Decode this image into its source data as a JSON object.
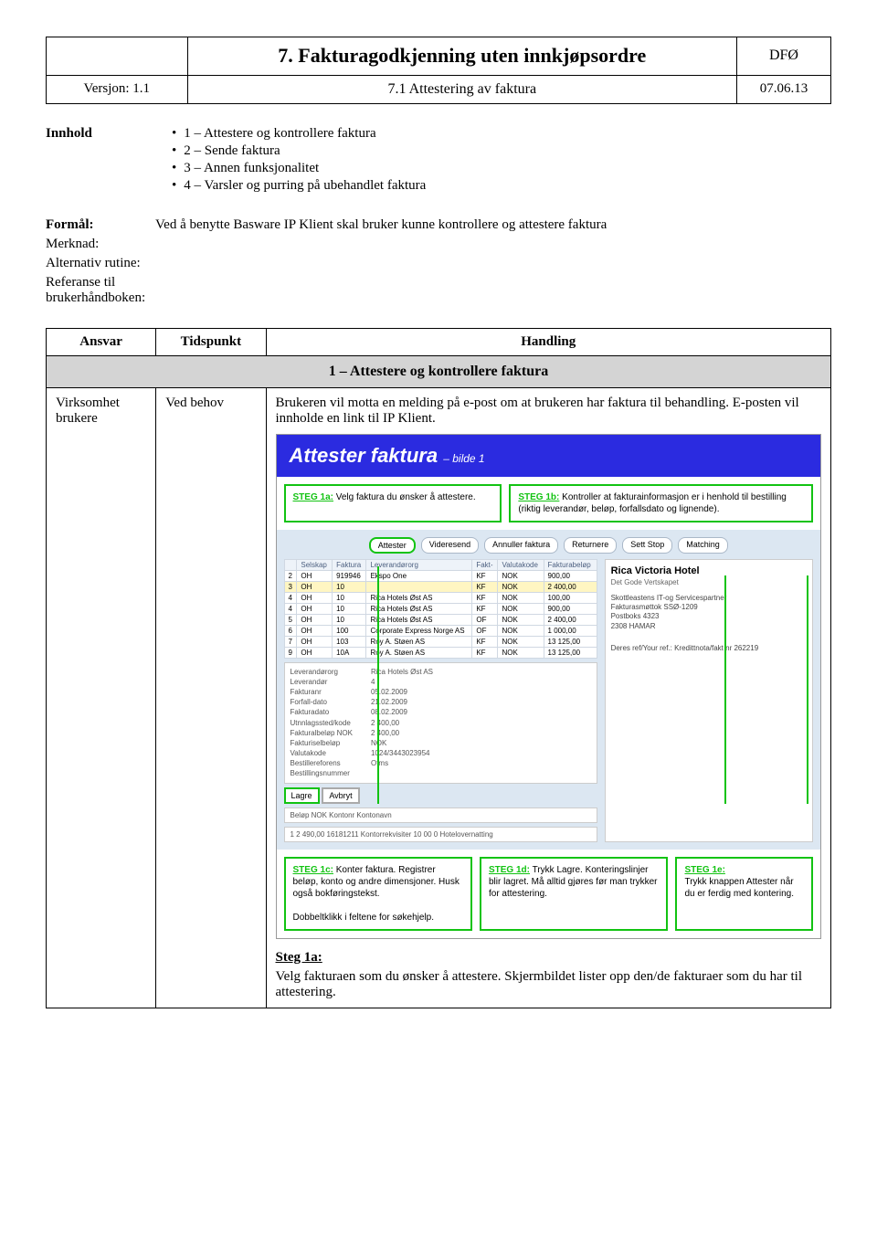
{
  "header": {
    "title": "7. Fakturagodkjenning uten innkjøpsordre",
    "org": "DFØ",
    "version_label": "Versjon: 1.1",
    "subtitle": "7.1 Attestering av faktura",
    "date": "07.06.13"
  },
  "innhold": {
    "label": "Innhold",
    "items": [
      "1 – Attestere og kontrollere faktura",
      "2 – Sende faktura",
      "3 – Annen funksjonalitet",
      "4 – Varsler og purring på ubehandlet faktura"
    ]
  },
  "meta": {
    "formal_label": "Formål:",
    "formal_text": "Ved å benytte Basware IP Klient skal bruker kunne kontrollere og attestere faktura",
    "merknad_label": "Merknad:",
    "altrutine_label": "Alternativ rutine:",
    "ref_label": "Referanse til brukerhåndboken:"
  },
  "table": {
    "h1": "Ansvar",
    "h2": "Tidspunkt",
    "h3": "Handling",
    "section1": "1 – Attestere og kontrollere faktura",
    "row1": {
      "ansvar": "Virksomhet brukere",
      "tidspunkt": "Ved behov",
      "handling_intro": "Brukeren vil motta en melding på e-post om at brukeren har faktura til behandling. E-posten vil innholde en link til IP Klient."
    }
  },
  "embed": {
    "title_main": "Attester faktura",
    "title_sub": "– bilde 1",
    "c_top_a_step": "STEG 1a:",
    "c_top_a_text": " Velg faktura du ønsker å attestere.",
    "c_top_b_step": "STEG 1b:",
    "c_top_b_text": " Kontroller at fakturainformasjon er i henhold til bestilling (riktig leverandør, beløp, forfallsdato og lignende).",
    "toolbar": [
      "Attester",
      "Videresend",
      "Annuller faktura",
      "Returnere",
      "Sett Stop",
      "Matching"
    ],
    "grid": {
      "cols": [
        "Selskap",
        "Faktura",
        "Leverandørorg",
        "Fakt-",
        "Valutakode",
        "Fakturabeløp"
      ],
      "rows": [
        [
          "2",
          "OH",
          "919946",
          "Ekspo One",
          "KF",
          "NOK",
          "900,00"
        ],
        [
          "3",
          "OH",
          "10",
          "",
          "KF",
          "NOK",
          "2 400,00"
        ],
        [
          "4",
          "OH",
          "10",
          "Rica Hotels Øst AS",
          "KF",
          "NOK",
          "100,00"
        ],
        [
          "4",
          "OH",
          "10",
          "Rica Hotels Øst AS",
          "KF",
          "NOK",
          "900,00"
        ],
        [
          "5",
          "OH",
          "10",
          "Rica Hotels Øst AS",
          "OF",
          "NOK",
          "2 400,00"
        ],
        [
          "6",
          "OH",
          "100",
          "Corporate Express Norge AS",
          "OF",
          "NOK",
          "1 000,00"
        ],
        [
          "7",
          "OH",
          "103",
          "Roy A. Støen AS",
          "KF",
          "NOK",
          "13 125,00"
        ],
        [
          "9",
          "OH",
          "10A",
          "Roy A. Støen AS",
          "KF",
          "NOK",
          "13 125,00"
        ]
      ]
    },
    "details_left": "Leverandørorg\nLeverandør\nFakturanr\nForfall-dato\nFakturadato\nUtnnlagssted/kode\nFakturalbeløp NOK\nFakturiselbeløp\nValutakode\nBestillereforens\nBestillingsnummer",
    "details_right": "Rica Hotels Øst AS\n4\n05.02.2009\n21.02.2009\n08.02.2009\n2 400,00\n2 400,00\nNOK\n1024/3443023954\nOfms",
    "lagre_btn": "Lagre",
    "avbryt_btn": "Avbryt",
    "kont_labels": "Beløp NOK   Kontonr   Kontonavn",
    "kont_values": "1   2 490,00   16181211   Kontorrekvisiter   10 00   0   Hotelovernatting",
    "right_logo": "Rica Victoria Hotel",
    "right_tag": "Det Gode Vertskapet",
    "right_info": "Skottleastens IT-og Servicespartner\nFakturasmøttok SSØ-1209\nPostboks 4323\n2308 HAMAR",
    "right_ref": "Deres ref/Your ref.:   Kredittnota/fakt nr 262219",
    "c_bot_c_step": "STEG 1c:",
    "c_bot_c_text": " Konter faktura. Registrer beløp, konto og andre dimensjoner. Husk også bokføringstekst.\n\nDobbeltklikk i feltene for søkehjelp.",
    "c_bot_d_step": "STEG 1d:",
    "c_bot_d_text": " Trykk Lagre. Konteringslinjer blir lagret. Må alltid gjøres før man trykker for attestering.",
    "c_bot_e_step": "STEG 1e:",
    "c_bot_e_text": "\nTrykk knappen Attester når du er ferdig med kontering."
  },
  "step1a": {
    "label": "Steg 1a:",
    "text": "Velg fakturaen som du ønsker å attestere. Skjermbildet lister opp den/de fakturaer som du har til attestering."
  }
}
